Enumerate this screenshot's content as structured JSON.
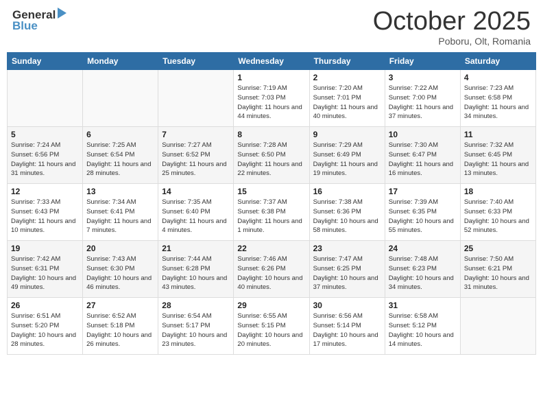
{
  "header": {
    "logo_line1": "General",
    "logo_line2": "Blue",
    "month": "October 2025",
    "location": "Poboru, Olt, Romania"
  },
  "weekdays": [
    "Sunday",
    "Monday",
    "Tuesday",
    "Wednesday",
    "Thursday",
    "Friday",
    "Saturday"
  ],
  "weeks": [
    [
      {
        "day": "",
        "info": ""
      },
      {
        "day": "",
        "info": ""
      },
      {
        "day": "",
        "info": ""
      },
      {
        "day": "1",
        "info": "Sunrise: 7:19 AM\nSunset: 7:03 PM\nDaylight: 11 hours and 44 minutes."
      },
      {
        "day": "2",
        "info": "Sunrise: 7:20 AM\nSunset: 7:01 PM\nDaylight: 11 hours and 40 minutes."
      },
      {
        "day": "3",
        "info": "Sunrise: 7:22 AM\nSunset: 7:00 PM\nDaylight: 11 hours and 37 minutes."
      },
      {
        "day": "4",
        "info": "Sunrise: 7:23 AM\nSunset: 6:58 PM\nDaylight: 11 hours and 34 minutes."
      }
    ],
    [
      {
        "day": "5",
        "info": "Sunrise: 7:24 AM\nSunset: 6:56 PM\nDaylight: 11 hours and 31 minutes."
      },
      {
        "day": "6",
        "info": "Sunrise: 7:25 AM\nSunset: 6:54 PM\nDaylight: 11 hours and 28 minutes."
      },
      {
        "day": "7",
        "info": "Sunrise: 7:27 AM\nSunset: 6:52 PM\nDaylight: 11 hours and 25 minutes."
      },
      {
        "day": "8",
        "info": "Sunrise: 7:28 AM\nSunset: 6:50 PM\nDaylight: 11 hours and 22 minutes."
      },
      {
        "day": "9",
        "info": "Sunrise: 7:29 AM\nSunset: 6:49 PM\nDaylight: 11 hours and 19 minutes."
      },
      {
        "day": "10",
        "info": "Sunrise: 7:30 AM\nSunset: 6:47 PM\nDaylight: 11 hours and 16 minutes."
      },
      {
        "day": "11",
        "info": "Sunrise: 7:32 AM\nSunset: 6:45 PM\nDaylight: 11 hours and 13 minutes."
      }
    ],
    [
      {
        "day": "12",
        "info": "Sunrise: 7:33 AM\nSunset: 6:43 PM\nDaylight: 11 hours and 10 minutes."
      },
      {
        "day": "13",
        "info": "Sunrise: 7:34 AM\nSunset: 6:41 PM\nDaylight: 11 hours and 7 minutes."
      },
      {
        "day": "14",
        "info": "Sunrise: 7:35 AM\nSunset: 6:40 PM\nDaylight: 11 hours and 4 minutes."
      },
      {
        "day": "15",
        "info": "Sunrise: 7:37 AM\nSunset: 6:38 PM\nDaylight: 11 hours and 1 minute."
      },
      {
        "day": "16",
        "info": "Sunrise: 7:38 AM\nSunset: 6:36 PM\nDaylight: 10 hours and 58 minutes."
      },
      {
        "day": "17",
        "info": "Sunrise: 7:39 AM\nSunset: 6:35 PM\nDaylight: 10 hours and 55 minutes."
      },
      {
        "day": "18",
        "info": "Sunrise: 7:40 AM\nSunset: 6:33 PM\nDaylight: 10 hours and 52 minutes."
      }
    ],
    [
      {
        "day": "19",
        "info": "Sunrise: 7:42 AM\nSunset: 6:31 PM\nDaylight: 10 hours and 49 minutes."
      },
      {
        "day": "20",
        "info": "Sunrise: 7:43 AM\nSunset: 6:30 PM\nDaylight: 10 hours and 46 minutes."
      },
      {
        "day": "21",
        "info": "Sunrise: 7:44 AM\nSunset: 6:28 PM\nDaylight: 10 hours and 43 minutes."
      },
      {
        "day": "22",
        "info": "Sunrise: 7:46 AM\nSunset: 6:26 PM\nDaylight: 10 hours and 40 minutes."
      },
      {
        "day": "23",
        "info": "Sunrise: 7:47 AM\nSunset: 6:25 PM\nDaylight: 10 hours and 37 minutes."
      },
      {
        "day": "24",
        "info": "Sunrise: 7:48 AM\nSunset: 6:23 PM\nDaylight: 10 hours and 34 minutes."
      },
      {
        "day": "25",
        "info": "Sunrise: 7:50 AM\nSunset: 6:21 PM\nDaylight: 10 hours and 31 minutes."
      }
    ],
    [
      {
        "day": "26",
        "info": "Sunrise: 6:51 AM\nSunset: 5:20 PM\nDaylight: 10 hours and 28 minutes."
      },
      {
        "day": "27",
        "info": "Sunrise: 6:52 AM\nSunset: 5:18 PM\nDaylight: 10 hours and 26 minutes."
      },
      {
        "day": "28",
        "info": "Sunrise: 6:54 AM\nSunset: 5:17 PM\nDaylight: 10 hours and 23 minutes."
      },
      {
        "day": "29",
        "info": "Sunrise: 6:55 AM\nSunset: 5:15 PM\nDaylight: 10 hours and 20 minutes."
      },
      {
        "day": "30",
        "info": "Sunrise: 6:56 AM\nSunset: 5:14 PM\nDaylight: 10 hours and 17 minutes."
      },
      {
        "day": "31",
        "info": "Sunrise: 6:58 AM\nSunset: 5:12 PM\nDaylight: 10 hours and 14 minutes."
      },
      {
        "day": "",
        "info": ""
      }
    ]
  ]
}
